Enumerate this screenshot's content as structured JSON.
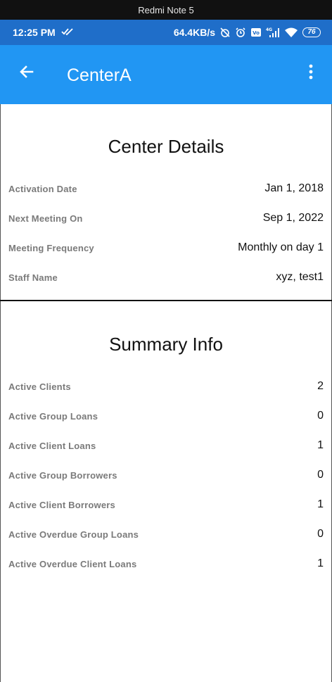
{
  "device": {
    "name": "Redmi Note 5"
  },
  "status_bar": {
    "time": "12:25 PM",
    "net_speed": "64.4KB/s",
    "battery": "76",
    "icons": [
      "double-check-icon",
      "alarm-off-icon",
      "alarm-icon",
      "volte-icon",
      "signal-4g-icon",
      "wifi-icon",
      "battery-icon"
    ]
  },
  "app_bar": {
    "title": "CenterA",
    "back_icon": "arrow-back-icon",
    "menu_icon": "more-vert-icon"
  },
  "center_details": {
    "title": "Center Details",
    "rows": [
      {
        "label": "Activation Date",
        "value": "Jan 1, 2018"
      },
      {
        "label": "Next Meeting On",
        "value": "Sep 1, 2022"
      },
      {
        "label": "Meeting Frequency",
        "value": "Monthly on day 1"
      },
      {
        "label": "Staff Name",
        "value": "xyz, test1"
      }
    ]
  },
  "summary_info": {
    "title": "Summary Info",
    "rows": [
      {
        "label": "Active Clients",
        "value": "2"
      },
      {
        "label": "Active Group Loans",
        "value": "0"
      },
      {
        "label": "Active Client Loans",
        "value": "1"
      },
      {
        "label": "Active Group Borrowers",
        "value": "0"
      },
      {
        "label": "Active Client Borrowers",
        "value": "1"
      },
      {
        "label": "Active Overdue Group Loans",
        "value": "0"
      },
      {
        "label": "Active Overdue Client Loans",
        "value": "1"
      }
    ]
  },
  "colors": {
    "app_bar": "#2196f3",
    "status_bar": "#1f6ec9",
    "label_text": "#7a7a7a",
    "value_text": "#111111"
  }
}
